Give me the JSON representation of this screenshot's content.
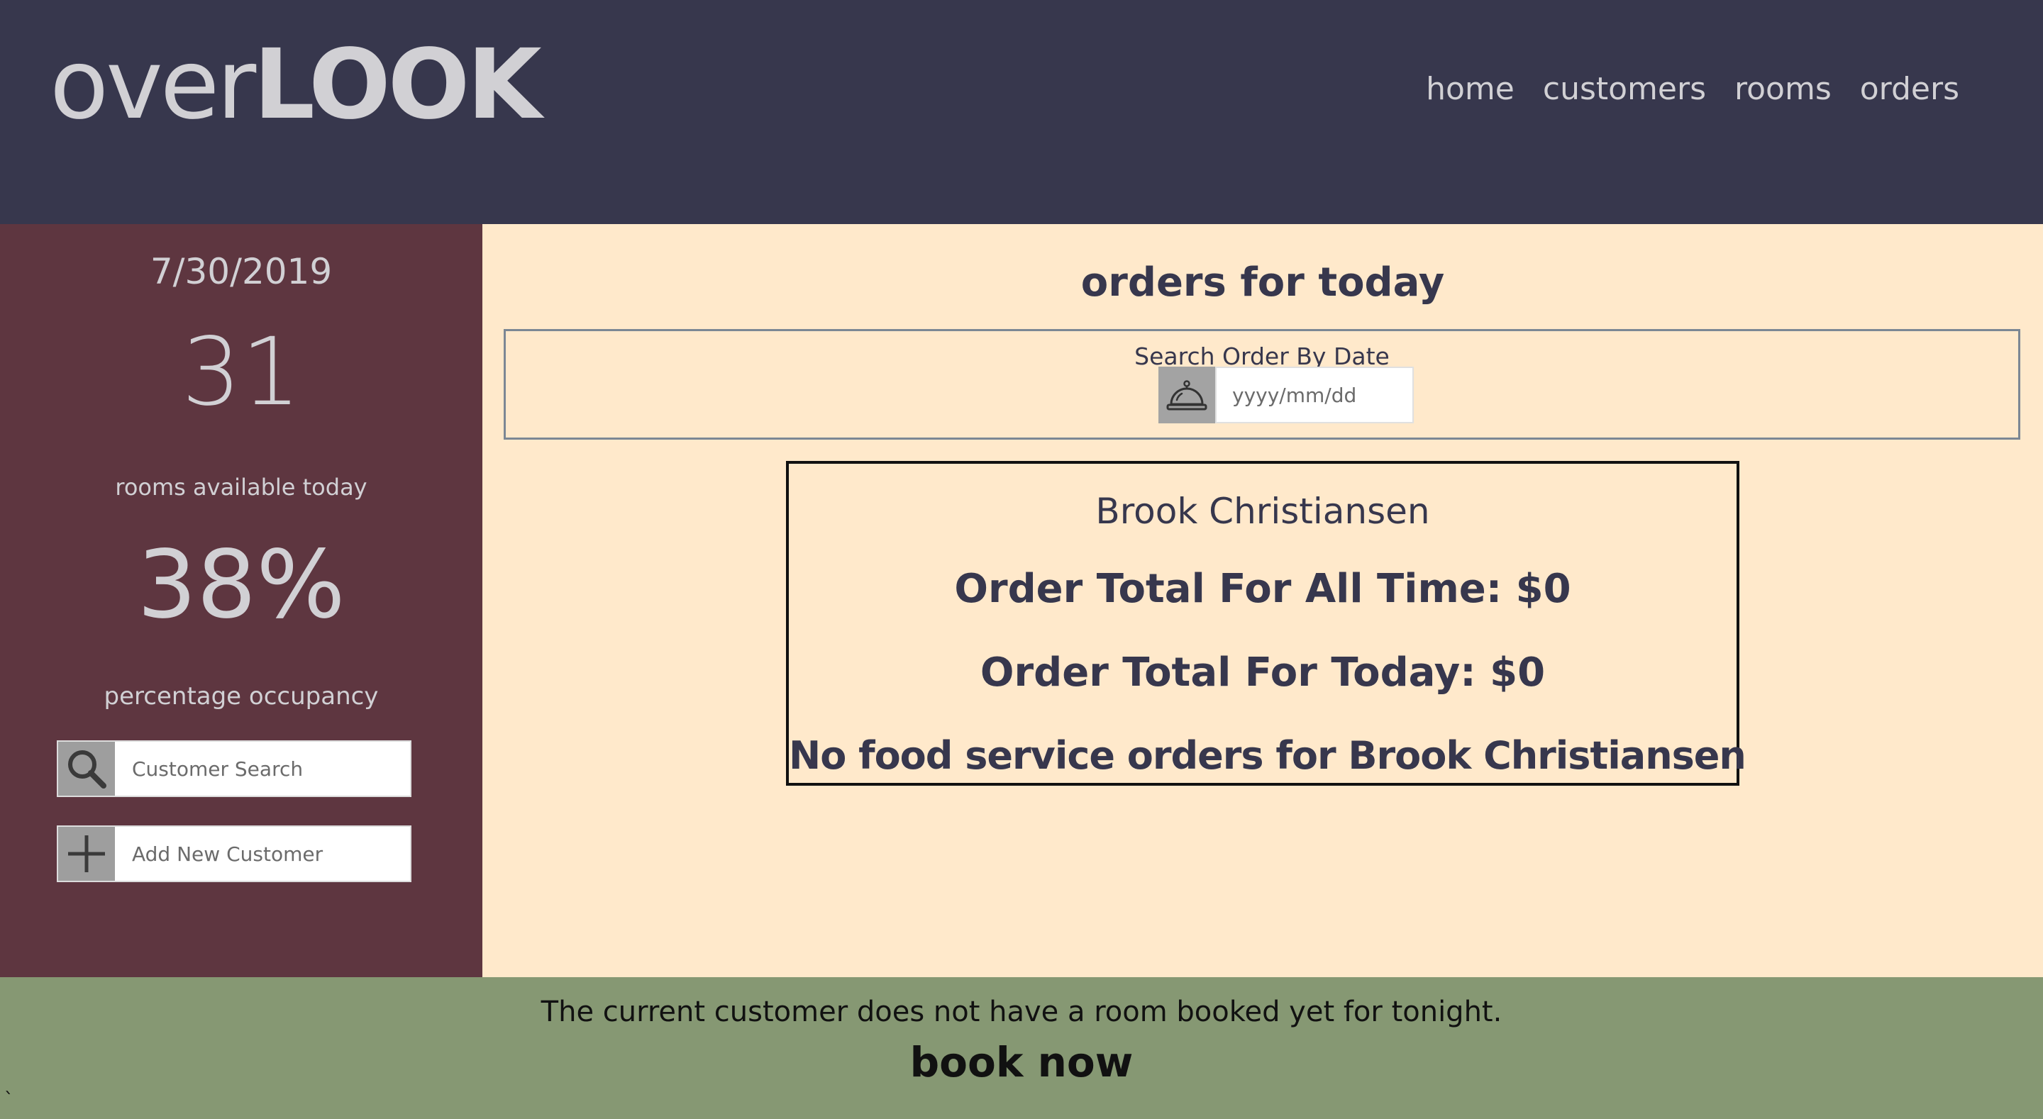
{
  "header": {
    "logo_light": "over",
    "logo_bold": "LOOK",
    "nav": [
      {
        "label": "home"
      },
      {
        "label": "customers"
      },
      {
        "label": "rooms"
      },
      {
        "label": "orders"
      }
    ]
  },
  "sidebar": {
    "date": "7/30/2019",
    "rooms_available": "31",
    "rooms_label": "rooms available today",
    "occupancy": "38%",
    "occupancy_label": "percentage occupancy",
    "search": {
      "placeholder": "Customer Search",
      "value": "",
      "icon": "magnifier-icon"
    },
    "add_customer": {
      "placeholder": "Add New Customer",
      "value": "",
      "icon": "plus-icon"
    }
  },
  "main": {
    "title": "orders for today",
    "search_label": "Search Order By Date",
    "date_input": {
      "placeholder": "yyyy/mm/dd",
      "value": "",
      "icon": "service-bell-icon"
    },
    "card": {
      "customer_name": "Brook Christiansen",
      "all_time_total": "Order Total For All Time: $0",
      "today_total": "Order Total For Today: $0",
      "no_orders": "No food service orders for Brook Christiansen"
    }
  },
  "footer": {
    "message": "The current customer does not have a room booked yet for tonight.",
    "book_label": "book now",
    "stray_char": "`"
  },
  "colors": {
    "header_bg": "#37374d",
    "sidebar_bg": "#5e3640",
    "main_bg": "#ffe9cb",
    "footer_bg": "#869873",
    "text_light": "#d1d0d4",
    "text_dark": "#37374d"
  }
}
